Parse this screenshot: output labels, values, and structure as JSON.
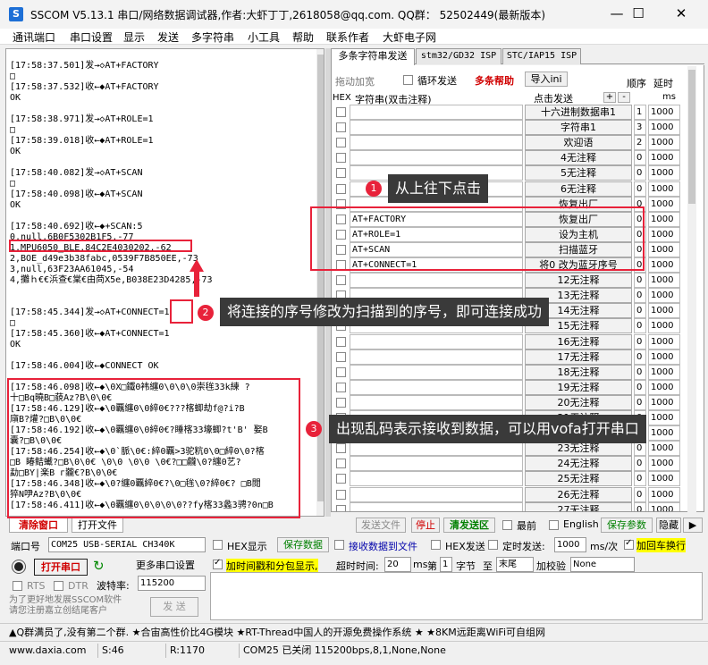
{
  "window": {
    "title": "SSCOM V5.13.1 串口/网络数据调试器,作者:大虾丁丁,2618058@qq.com. QQ群： 52502449(最新版本)"
  },
  "menu": [
    "通讯端口",
    "串口设置",
    "显示",
    "发送",
    "多字符串",
    "小工具",
    "帮助",
    "联系作者",
    "大虾电子网"
  ],
  "log": [
    "[17:58:37.501]发→◇AT+FACTORY",
    "□",
    "[17:58:37.532]收←◆AT+FACTORY",
    "OK",
    "[17:58:38.971]发→◇AT+ROLE=1",
    "□",
    "[17:58:39.018]收←◆AT+ROLE=1",
    "OK",
    "[17:58:40.082]发→◇AT+SCAN",
    "□",
    "[17:58:40.098]收←◆AT+SCAN",
    "OK",
    "[17:58:40.692]收←◆+SCAN:5",
    "0,null,6B0F5302B1F5,-77",
    "1,MPU6050_BLE,84C2E4030202,-62",
    "2,BOE_d49e3b38fabc,0539F7B850EE,-73",
    "3,null,63F23AA61045,-54",
    "4,攤ｈ€€浜查€棠€由苘X5e,B038E23D4285,-73",
    "[17:58:45.344]发→◇AT+CONNECT=1",
    "□",
    "[17:58:45.360]收←◆AT+CONNECT=1",
    "OK",
    "[17:58:46.004]收←◆CONNECT OK",
    "[17:58:46.098]收←◆\\0X□鐵0袆纏0\\0\\0\\0崇毪33k練   ?",
    "十□Bq曉B□藐Az?B\\0\\0€",
    "[17:58:46.129]收←◆\\0覊纏0\\0綷0€???楁蝍劫f@?i?B",
    "廎B?爟?□B\\0\\0€",
    "[17:58:46.192]收←◆\\0覊纏0\\0綷0€?睡楁33壕蝍?t'B' 娶B",
    "囊?□B\\0\\0€",
    "[17:58:46.254]收←◆\\0`脈\\0€:綷0覊>3驼粇0\\0□綷0\\0?楁",
    "□B  睶鲒蠘?□B\\0\\0€  \\0\\0   \\0\\0   \\0€?□□龖\\0?纏0艺?",
    "勐□BY|楽B г龖€?B\\0\\0€",
    "[17:58:46.348]收←◆\\0?纏0覊綷0€?\\0□毪\\0?綷0€?  □B閲",
    "猝N吚Az?B\\0\\0€",
    "[17:58:46.411]收←◆\\0覊纏0\\0\\0\\0\\0??fy楁33蠡3骋?0n□B"
  ],
  "tabs": [
    "多条字符串发送",
    "stm32/GD32 ISP",
    "STC/IAP15 ISP"
  ],
  "multi": {
    "drag_add": "拖动加宽",
    "loop_send": "循环发送",
    "help": "多条帮助",
    "import": "导入ini",
    "order": "顺序",
    "delay": "延时",
    "hex": "HEX",
    "str_hdr": "字符串(双击注释)",
    "send_hdr": "点击发送",
    "plus": "+",
    "minus": "-",
    "ms": "ms"
  },
  "rows": [
    {
      "text": "",
      "btn": "十六进制数据串1",
      "ord": "1",
      "delay": "1000"
    },
    {
      "text": "",
      "btn": "字符串1",
      "ord": "3",
      "delay": "1000"
    },
    {
      "text": "",
      "btn": "欢迎语",
      "ord": "2",
      "delay": "1000"
    },
    {
      "text": "",
      "btn": "4无注释",
      "ord": "0",
      "delay": "1000"
    },
    {
      "text": "",
      "btn": "5无注释",
      "ord": "0",
      "delay": "1000"
    },
    {
      "text": "",
      "btn": "6无注释",
      "ord": "0",
      "delay": "1000"
    },
    {
      "text": "",
      "btn": "恢复出厂",
      "ord": "0",
      "delay": "1000"
    },
    {
      "text": "AT+FACTORY",
      "btn": "恢复出厂",
      "ord": "0",
      "delay": "1000"
    },
    {
      "text": "AT+ROLE=1",
      "btn": "设为主机",
      "ord": "0",
      "delay": "1000"
    },
    {
      "text": "AT+SCAN",
      "btn": "扫描蓝牙",
      "ord": "0",
      "delay": "1000"
    },
    {
      "text": "AT+CONNECT=1",
      "btn": "将0 改为蓝牙序号",
      "ord": "0",
      "delay": "1000"
    },
    {
      "text": "",
      "btn": "12无注释",
      "ord": "0",
      "delay": "1000"
    },
    {
      "text": "",
      "btn": "13无注释",
      "ord": "0",
      "delay": "1000"
    },
    {
      "text": "",
      "btn": "14无注释",
      "ord": "0",
      "delay": "1000"
    },
    {
      "text": "",
      "btn": "15无注释",
      "ord": "0",
      "delay": "1000"
    },
    {
      "text": "",
      "btn": "16无注释",
      "ord": "0",
      "delay": "1000"
    },
    {
      "text": "",
      "btn": "17无注释",
      "ord": "0",
      "delay": "1000"
    },
    {
      "text": "",
      "btn": "18无注释",
      "ord": "0",
      "delay": "1000"
    },
    {
      "text": "",
      "btn": "19无注释",
      "ord": "0",
      "delay": "1000"
    },
    {
      "text": "",
      "btn": "20无注释",
      "ord": "0",
      "delay": "1000"
    },
    {
      "text": "",
      "btn": "21无注释",
      "ord": "0",
      "delay": "1000"
    },
    {
      "text": "",
      "btn": "22无注释",
      "ord": "0",
      "delay": "1000"
    },
    {
      "text": "",
      "btn": "23无注释",
      "ord": "0",
      "delay": "1000"
    },
    {
      "text": "",
      "btn": "24无注释",
      "ord": "0",
      "delay": "1000"
    },
    {
      "text": "",
      "btn": "25无注释",
      "ord": "0",
      "delay": "1000"
    },
    {
      "text": "",
      "btn": "26无注释",
      "ord": "0",
      "delay": "1000"
    },
    {
      "text": "",
      "btn": "27无注释",
      "ord": "0",
      "delay": "1000"
    }
  ],
  "bottom": {
    "clear_window": "清除窗口",
    "open_file": "打开文件",
    "send_file": "发送文件",
    "stop": "停止",
    "clear_send": "清发送区",
    "latest": "最前",
    "english": "English",
    "save_params": "保存参数",
    "hide": "隐藏",
    "port_label": "端口号",
    "port_value": "COM25 USB-SERIAL CH340K",
    "hex_display": "HEX显示",
    "save_data": "保存数据",
    "recv_to_file": "接收数据到文件",
    "hex_send": "HEX发送",
    "timed_send": "定时发送:",
    "timed_value": "1000",
    "ms_per": "ms/次",
    "add_crlf": "加回车换行",
    "open_port": "打开串口",
    "more_settings": "更多串口设置",
    "timestamp": "加时间戳和分包显示,",
    "timeout_label": "超时时间:",
    "timeout_value": "20",
    "ms": "ms",
    "nth": "第",
    "nth_value": "1",
    "byte_label": "字节",
    "to_label": "至",
    "to_value": "末尾",
    "checksum_label": "加校验",
    "checksum_value": "None",
    "rts": "RTS",
    "dtr": "DTR",
    "baud_label": "波特率:",
    "baud_value": "115200",
    "promo": "为了更好地发展SSCOM软件\n请您注册嘉立创结尾客户",
    "send": "发 送"
  },
  "ad": "▲Q群满员了,没有第二个群. ★合宙高性价比4G模块 ★RT-Thread中国人的开源免费操作系统 ★ ★8KM远距离WiFi可自组网",
  "status": {
    "site": "www.daxia.com",
    "s": "S:46",
    "r": "R:1170",
    "port": "COM25 已关闭  115200bps,8,1,None,None"
  },
  "annotations": {
    "c1": "从上往下点击",
    "c2": "将连接的序号修改为扫描到的序号，即可连接成功",
    "c3": "出现乱码表示接收到数据，可以用vofa打开串口",
    "n1": "1",
    "n2": "2",
    "n3": "3"
  }
}
